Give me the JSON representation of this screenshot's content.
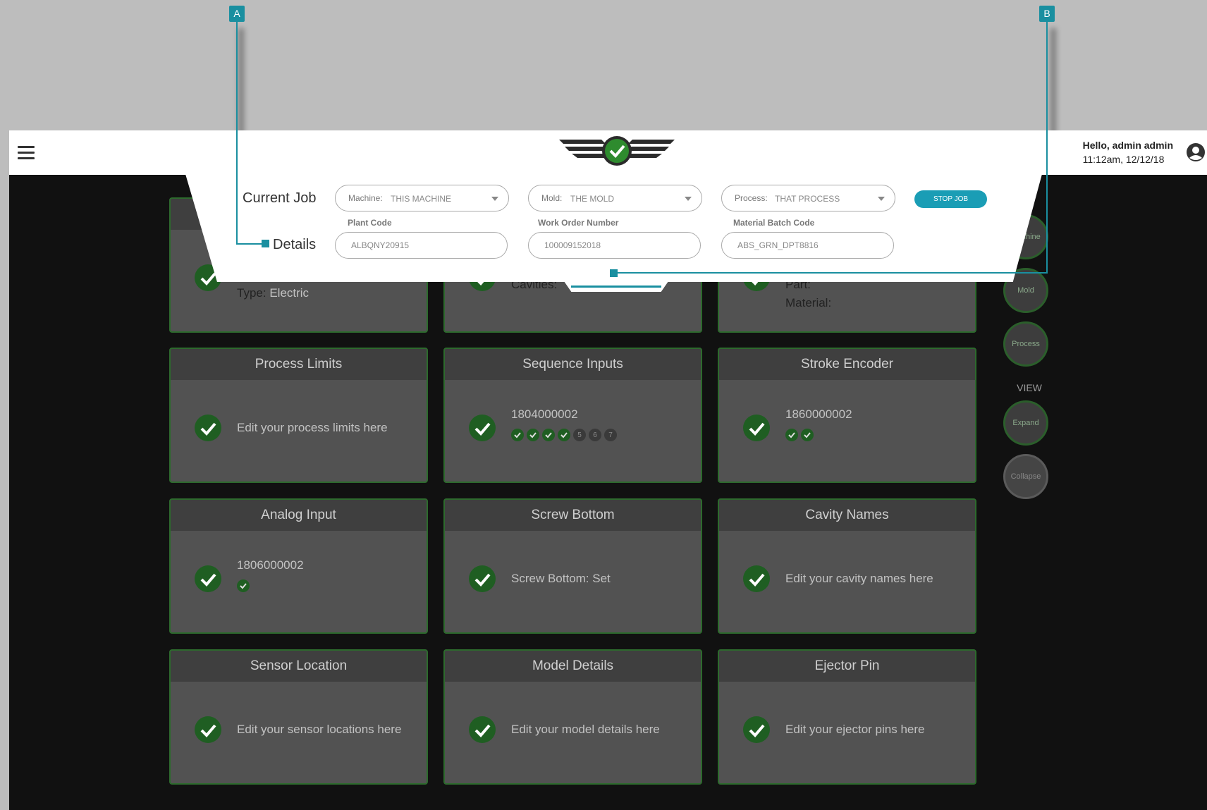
{
  "header": {
    "greeting": "Hello, admin admin",
    "timestamp": "11:12am, 12/12/18"
  },
  "colors": {
    "accent": "#1a9db5",
    "callout": "#1a8fa0",
    "ok": "#1f5e22"
  },
  "job": {
    "current_job_label": "Current Job",
    "details_label": "Details",
    "machine": {
      "key": "Machine:",
      "value": "THIS MACHINE"
    },
    "mold": {
      "key": "Mold:",
      "value": "THE MOLD"
    },
    "process": {
      "key": "Process:",
      "value": "THAT PROCESS"
    },
    "stop_label": "STOP JOB",
    "plant_code": {
      "label": "Plant Code",
      "value": "ALBQNY20915"
    },
    "work_order": {
      "label": "Work Order Number",
      "value": "100009152018"
    },
    "batch_code": {
      "label": "Material Batch Code",
      "value": "ABS_GRN_DPT8816"
    }
  },
  "partial_row": {
    "type_key": "Type:",
    "type_value": "Electric",
    "cavities": "Cavities:",
    "part": "Part:",
    "material": "Material:"
  },
  "cards": [
    {
      "title": "Process Limits",
      "text": "Edit your process limits here"
    },
    {
      "title": "Sequence Inputs",
      "text": "1804000002",
      "dots": [
        "ok",
        "ok",
        "ok",
        "ok",
        "5",
        "6",
        "7"
      ]
    },
    {
      "title": "Stroke Encoder",
      "text": "1860000002",
      "dots": [
        "ok",
        "ok"
      ]
    },
    {
      "title": "Analog Input",
      "text": "1806000002",
      "dots": [
        "ok"
      ]
    },
    {
      "title": "Screw Bottom",
      "text": "Screw Bottom: Set"
    },
    {
      "title": "Cavity Names",
      "text": "Edit your cavity names here"
    },
    {
      "title": "Sensor Location",
      "text": "Edit your sensor locations here"
    },
    {
      "title": "Model Details",
      "text": "Edit your model details here"
    },
    {
      "title": "Ejector Pin",
      "text": "Edit your ejector pins here"
    }
  ],
  "rail": {
    "machine": "Machine",
    "mold": "Mold",
    "process": "Process",
    "view_label": "VIEW",
    "expand": "Expand",
    "collapse": "Collapse"
  },
  "callouts": {
    "a": "A",
    "b": "B"
  }
}
